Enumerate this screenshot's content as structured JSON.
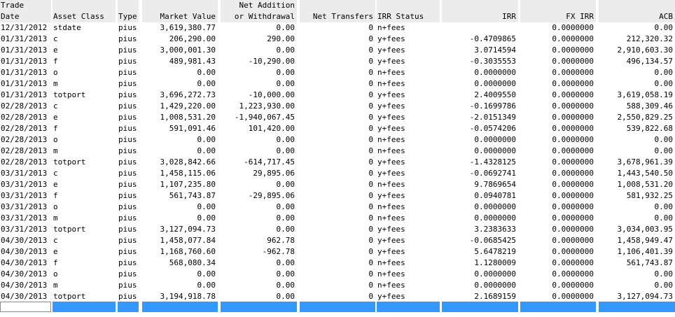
{
  "header": {
    "line1": [
      "Trade",
      "",
      "",
      "",
      "Net Addition",
      "",
      "",
      "",
      "",
      ""
    ],
    "line2": [
      "Date",
      "Asset Class",
      "Type",
      "Market Value",
      "or Withdrawal",
      "Net Transfers",
      "IRR Status",
      "IRR",
      "FX IRR",
      "ACB"
    ]
  },
  "rows": [
    [
      "12/31/2012",
      "stdate",
      "pius",
      "3,619,380.77",
      "0.00",
      "0",
      "n+fees",
      "",
      "0.0000000",
      "0.00"
    ],
    [
      "01/31/2013",
      "c",
      "pius",
      "206,290.00",
      "290.00",
      "0",
      "y+fees",
      "-0.4709865",
      "0.0000000",
      "212,320.32"
    ],
    [
      "01/31/2013",
      "e",
      "pius",
      "3,000,001.30",
      "0.00",
      "0",
      "y+fees",
      "3.0714594",
      "0.0000000",
      "2,910,603.30"
    ],
    [
      "01/31/2013",
      "f",
      "pius",
      "489,981.43",
      "-10,290.00",
      "0",
      "y+fees",
      "-0.3035553",
      "0.0000000",
      "496,134.57"
    ],
    [
      "01/31/2013",
      "o",
      "pius",
      "0.00",
      "0.00",
      "0",
      "n+fees",
      "0.0000000",
      "0.0000000",
      "0.00"
    ],
    [
      "01/31/2013",
      "m",
      "pius",
      "0.00",
      "0.00",
      "0",
      "n+fees",
      "0.0000000",
      "0.0000000",
      "0.00"
    ],
    [
      "01/31/2013",
      "totport",
      "pius",
      "3,696,272.73",
      "-10,000.00",
      "0",
      "y+fees",
      "2.4009550",
      "0.0000000",
      "3,619,058.19"
    ],
    [
      "02/28/2013",
      "c",
      "pius",
      "1,429,220.00",
      "1,223,930.00",
      "0",
      "y+fees",
      "-0.1699786",
      "0.0000000",
      "588,309.46"
    ],
    [
      "02/28/2013",
      "e",
      "pius",
      "1,008,531.20",
      "-1,940,067.45",
      "0",
      "y+fees",
      "-2.0151349",
      "0.0000000",
      "2,550,829.25"
    ],
    [
      "02/28/2013",
      "f",
      "pius",
      "591,091.46",
      "101,420.00",
      "0",
      "y+fees",
      "-0.0574206",
      "0.0000000",
      "539,822.68"
    ],
    [
      "02/28/2013",
      "o",
      "pius",
      "0.00",
      "0.00",
      "0",
      "n+fees",
      "0.0000000",
      "0.0000000",
      "0.00"
    ],
    [
      "02/28/2013",
      "m",
      "pius",
      "0.00",
      "0.00",
      "0",
      "n+fees",
      "0.0000000",
      "0.0000000",
      "0.00"
    ],
    [
      "02/28/2013",
      "totport",
      "pius",
      "3,028,842.66",
      "-614,717.45",
      "0",
      "y+fees",
      "-1.4328125",
      "0.0000000",
      "3,678,961.39"
    ],
    [
      "03/31/2013",
      "c",
      "pius",
      "1,458,115.06",
      "29,895.06",
      "0",
      "y+fees",
      "-0.0692741",
      "0.0000000",
      "1,443,540.50"
    ],
    [
      "03/31/2013",
      "e",
      "pius",
      "1,107,235.80",
      "0.00",
      "0",
      "n+fees",
      "9.7869654",
      "0.0000000",
      "1,008,531.20"
    ],
    [
      "03/31/2013",
      "f",
      "pius",
      "561,743.87",
      "-29,895.06",
      "0",
      "y+fees",
      "0.0940781",
      "0.0000000",
      "581,932.25"
    ],
    [
      "03/31/2013",
      "o",
      "pius",
      "0.00",
      "0.00",
      "0",
      "n+fees",
      "0.0000000",
      "0.0000000",
      "0.00"
    ],
    [
      "03/31/2013",
      "m",
      "pius",
      "0.00",
      "0.00",
      "0",
      "n+fees",
      "0.0000000",
      "0.0000000",
      "0.00"
    ],
    [
      "03/31/2013",
      "totport",
      "pius",
      "3,127,094.73",
      "0.00",
      "0",
      "y+fees",
      "3.2383633",
      "0.0000000",
      "3,034,003.95"
    ],
    [
      "04/30/2013",
      "c",
      "pius",
      "1,458,077.84",
      "962.78",
      "0",
      "y+fees",
      "-0.0685425",
      "0.0000000",
      "1,458,949.47"
    ],
    [
      "04/30/2013",
      "e",
      "pius",
      "1,168,760.60",
      "-962.78",
      "0",
      "y+fees",
      "5.6478219",
      "0.0000000",
      "1,106,401.39"
    ],
    [
      "04/30/2013",
      "f",
      "pius",
      "568,080.34",
      "0.00",
      "0",
      "n+fees",
      "1.1280009",
      "0.0000000",
      "561,743.87"
    ],
    [
      "04/30/2013",
      "o",
      "pius",
      "0.00",
      "0.00",
      "0",
      "n+fees",
      "0.0000000",
      "0.0000000",
      "0.00"
    ],
    [
      "04/30/2013",
      "m",
      "pius",
      "0.00",
      "0.00",
      "0",
      "n+fees",
      "0.0000000",
      "0.0000000",
      "0.00"
    ],
    [
      "04/30/2013",
      "totport",
      "pius",
      "3,194,918.78",
      "0.00",
      "0",
      "y+fees",
      "2.1689159",
      "0.0000000",
      "3,127,094.73"
    ]
  ],
  "footer": {
    "edit_value": ""
  },
  "colors": {
    "header_bg": "#ececec",
    "footer_bar": "#3399ff"
  }
}
